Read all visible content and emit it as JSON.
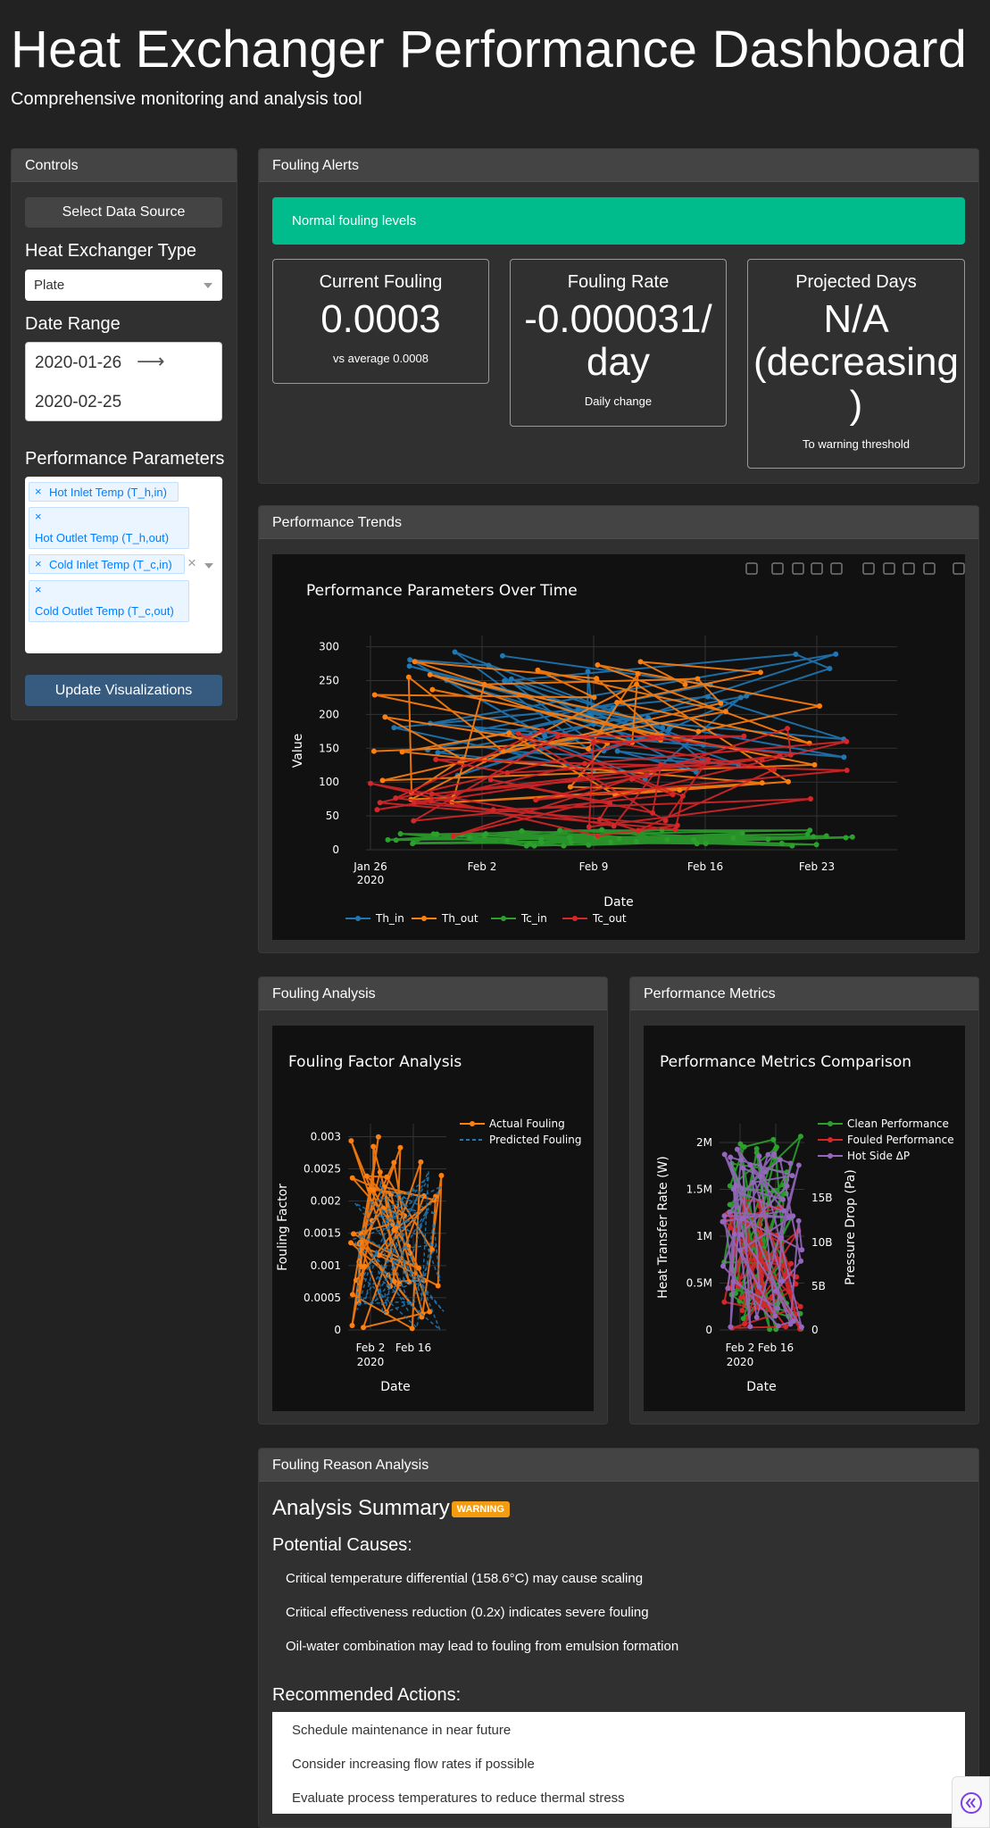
{
  "header": {
    "title": "Heat Exchanger Performance Dashboard",
    "subtitle": "Comprehensive monitoring and analysis tool"
  },
  "controls": {
    "header": "Controls",
    "select_source_label": "Select Data Source",
    "hx_type_label": "Heat Exchanger Type",
    "hx_type_value": "Plate",
    "date_range_label": "Date Range",
    "date_start": "2020-01-26",
    "date_arrow": "⟶",
    "date_end": "2020-02-25",
    "params_label": "Performance Parameters",
    "param_chips": [
      "Hot Inlet Temp (T_h,in)",
      "Hot Outlet Temp (T_h,out)",
      "Cold Inlet Temp (T_c,in)",
      "Cold Outlet Temp (T_c,out)"
    ],
    "chip_remove": "×",
    "clear_icon": "×",
    "update_label": "Update Visualizations"
  },
  "fouling_alerts": {
    "header": "Fouling Alerts",
    "alert_text": "Normal fouling levels",
    "current": {
      "title": "Current Fouling",
      "value": "0.0003",
      "sub": "vs average 0.0008"
    },
    "rate": {
      "title": "Fouling Rate",
      "value_line1": "-0.000031/",
      "value_line2": "day",
      "sub": "Daily change"
    },
    "projected": {
      "title": "Projected Days",
      "value_line1": "N/A",
      "value_line2": "(decreasing",
      "value_line3": ")",
      "sub": "To warning threshold"
    }
  },
  "performance_trends": {
    "header": "Performance Trends",
    "chart_data": {
      "type": "line",
      "title": "Performance Parameters Over Time",
      "xlabel": "Date",
      "ylabel": "Value",
      "ylim": [
        0,
        310
      ],
      "yticks": [
        0,
        50,
        100,
        150,
        200,
        250,
        300
      ],
      "xticks": [
        "Jan 26",
        "Feb 2",
        "Feb 9",
        "Feb 16",
        "Feb 23"
      ],
      "xtick_sub": "2020",
      "legend_position": "bottom",
      "series": [
        {
          "name": "Th_in",
          "color": "#1f77b4",
          "range": [
            100,
            295
          ]
        },
        {
          "name": "Th_out",
          "color": "#ff7f0e",
          "range": [
            70,
            280
          ]
        },
        {
          "name": "Tc_in",
          "color": "#2ca02c",
          "range": [
            5,
            30
          ]
        },
        {
          "name": "Tc_out",
          "color": "#d62728",
          "range": [
            20,
            180
          ]
        }
      ]
    }
  },
  "fouling_analysis": {
    "header": "Fouling Analysis",
    "chart_data": {
      "type": "line",
      "title": "Fouling Factor Analysis",
      "xlabel": "Date",
      "ylabel": "Fouling Factor",
      "ylim": [
        0,
        0.0032
      ],
      "yticks": [
        "0",
        "0.0005",
        "0.001",
        "0.0015",
        "0.002",
        "0.0025",
        "0.003"
      ],
      "xticks": [
        "Feb 2",
        "Feb 16"
      ],
      "xtick_sub": "2020",
      "legend_position": "top-right",
      "series": [
        {
          "name": "Actual Fouling",
          "color": "#ff7f0e",
          "range": [
            0,
            0.003
          ]
        },
        {
          "name": "Predicted Fouling",
          "color": "#1f77b4",
          "range": [
            0,
            0.0025
          ]
        }
      ]
    }
  },
  "performance_metrics": {
    "header": "Performance Metrics",
    "chart_data": {
      "type": "line",
      "title": "Performance Metrics Comparison",
      "xlabel": "Date",
      "ylabel": "Heat Transfer Rate (W)",
      "y2label": "Pressure Drop (Pa)",
      "yticks": [
        "0",
        "0.5M",
        "1M",
        "1.5M",
        "2M"
      ],
      "y2ticks": [
        "0",
        "5B",
        "10B",
        "15B"
      ],
      "xticks": [
        "Feb 2",
        "Feb 16"
      ],
      "xtick_sub": "2020",
      "legend_position": "top-right",
      "series": [
        {
          "name": "Clean Performance",
          "color": "#2ca02c",
          "range": [
            0,
            2100000
          ]
        },
        {
          "name": "Fouled Performance",
          "color": "#d62728",
          "range": [
            0,
            1400000
          ]
        },
        {
          "name": "Hot Side ΔP",
          "color": "#9467bd",
          "range": [
            0,
            2000000
          ]
        }
      ]
    }
  },
  "reason_analysis": {
    "header": "Fouling Reason Analysis",
    "summary_title": "Analysis Summary",
    "badge": "WARNING",
    "causes_title": "Potential Causes:",
    "causes": [
      "Critical temperature differential (158.6°C) may cause scaling",
      "Critical effectiveness reduction (0.2x) indicates severe fouling",
      "Oil-water combination may lead to fouling from emulsion formation"
    ],
    "actions_title": "Recommended Actions:",
    "actions": [
      "Schedule maintenance in near future",
      "Consider increasing flow rates if possible",
      "Evaluate process temperatures to reduce thermal stress"
    ]
  },
  "colors": {
    "background": "#222222",
    "card": "#303030",
    "card_header": "#444444",
    "primary": "#375a7f",
    "success": "#00bc8c",
    "warning": "#f39c12"
  }
}
